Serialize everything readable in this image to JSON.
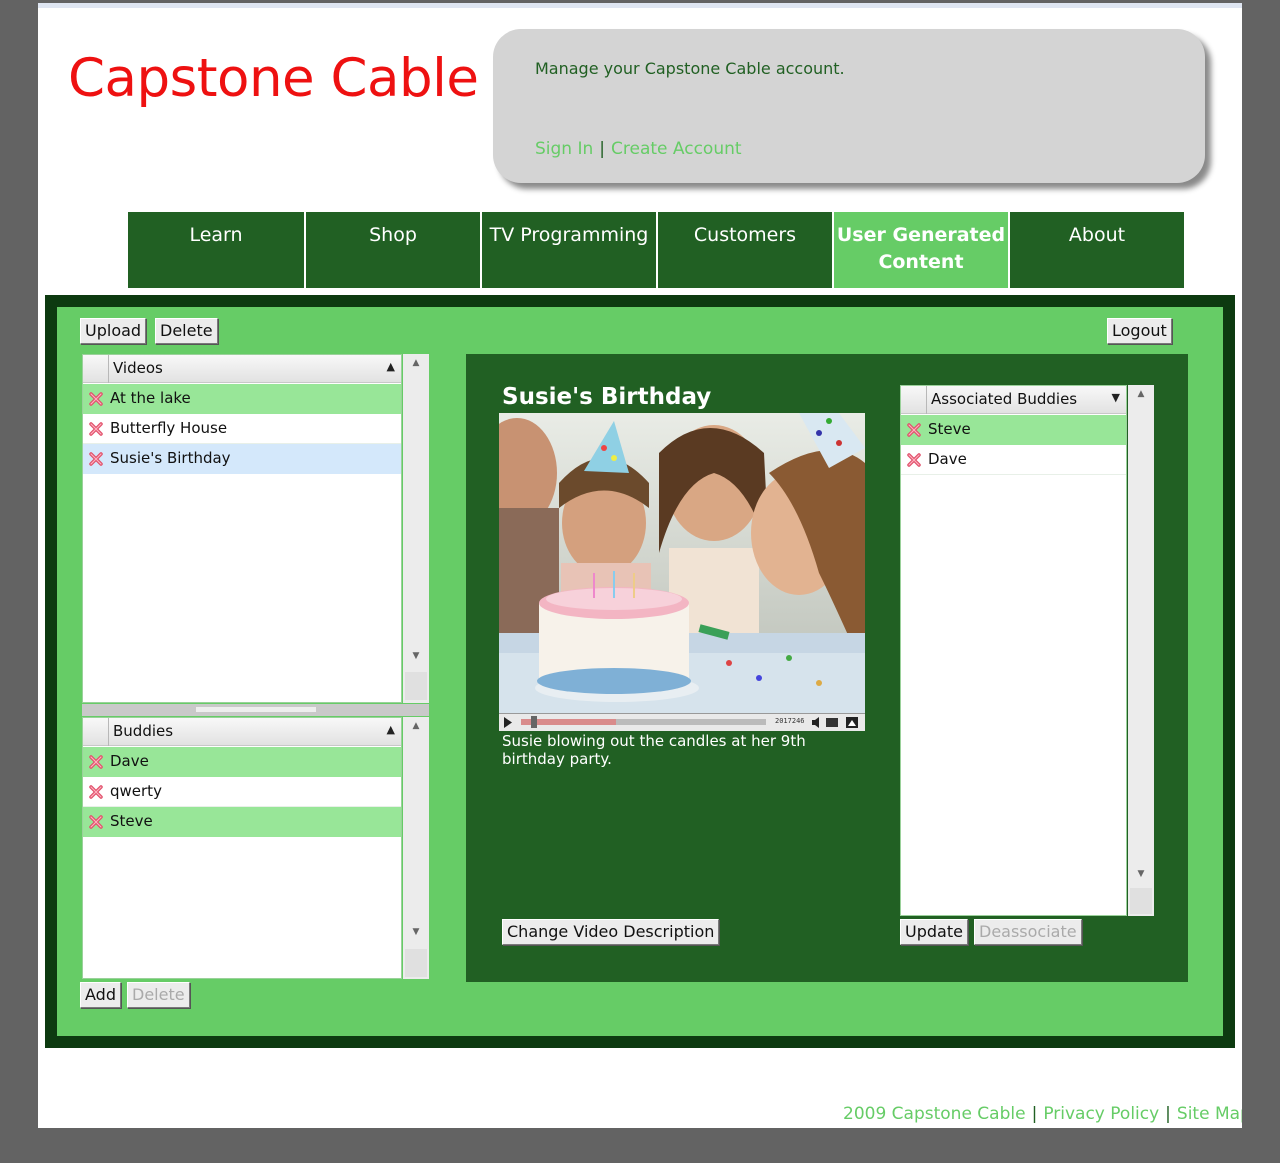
{
  "brand": {
    "name": "Capstone Cable"
  },
  "account": {
    "message": "Manage your Capstone Cable account.",
    "sign_in": "Sign In",
    "separator": "|",
    "create_account": "Create Account"
  },
  "nav": {
    "items": [
      {
        "label": "Learn"
      },
      {
        "label": "Shop"
      },
      {
        "label": "TV Programming"
      },
      {
        "label": "Customers"
      },
      {
        "label": "User Generated Content",
        "active": true
      },
      {
        "label": "About"
      }
    ]
  },
  "toolbar": {
    "upload": "Upload",
    "delete": "Delete",
    "logout": "Logout"
  },
  "videos": {
    "header": "Videos",
    "items": [
      {
        "label": "At the lake",
        "state": "highlighted"
      },
      {
        "label": "Butterfly House",
        "state": "normal"
      },
      {
        "label": "Susie's Birthday",
        "state": "selected"
      }
    ]
  },
  "buddies": {
    "header": "Buddies",
    "items": [
      {
        "label": "Dave",
        "state": "highlighted"
      },
      {
        "label": "qwerty",
        "state": "normal"
      },
      {
        "label": "Steve",
        "state": "highlighted"
      }
    ],
    "add": "Add",
    "delete": "Delete"
  },
  "video_panel": {
    "title": "Susie's Birthday",
    "description": "Susie blowing out the candles at her 9th birthday party.",
    "time": "2017246",
    "change_description": "Change Video Description"
  },
  "associated": {
    "header": "Associated Buddies",
    "items": [
      {
        "label": "Steve",
        "state": "highlighted"
      },
      {
        "label": "Dave",
        "state": "normal"
      }
    ],
    "update": "Update",
    "deassociate": "Deassociate"
  },
  "footer": {
    "copyright": "2009 Capstone Cable",
    "separator": "|",
    "privacy": "Privacy Policy",
    "sitemap": "Site Map"
  },
  "colors": {
    "brand_red": "#ee1111",
    "dark_green": "#216023",
    "light_green": "#66cc66",
    "row_green": "#98e698",
    "row_selected": "#d4e8fb"
  }
}
